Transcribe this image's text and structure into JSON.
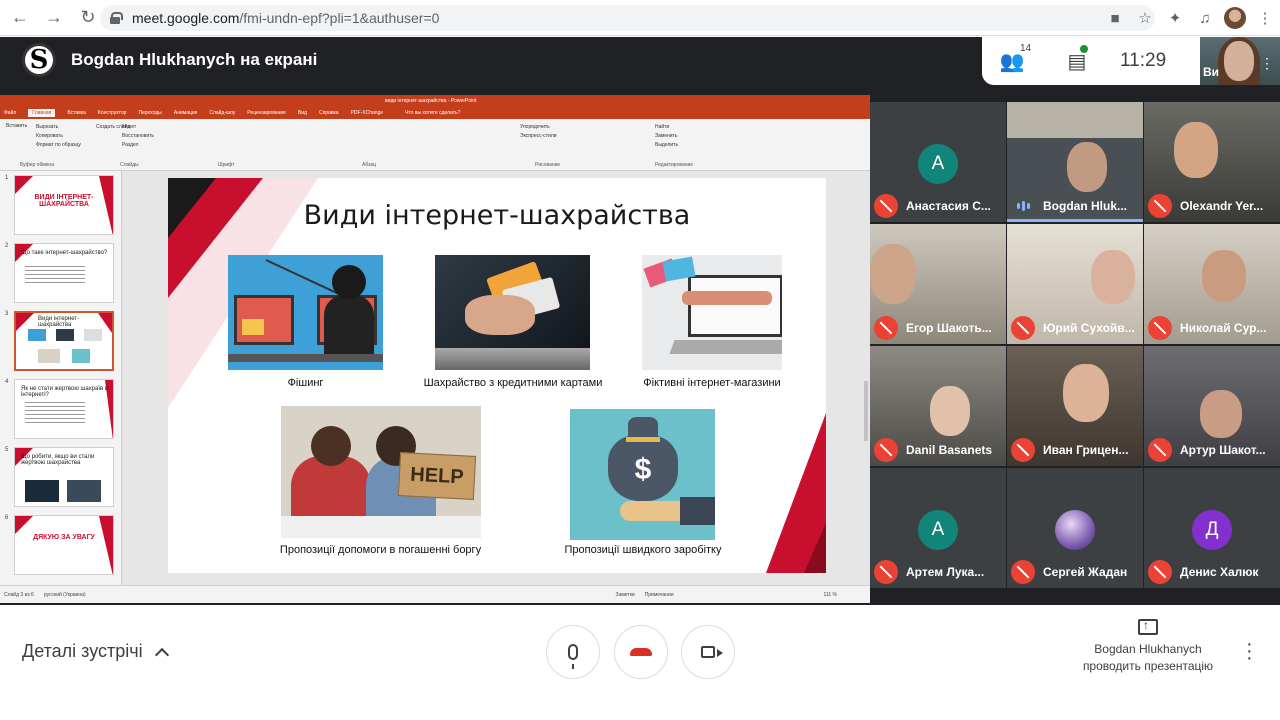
{
  "browser": {
    "url_host": "meet.google.com",
    "url_path": "/fmi-undn-epf?pli=1&authuser=0"
  },
  "meet": {
    "presenter_initial": "S",
    "presenter_banner": "Bogdan Hlukhanych на екрані",
    "people_count": "14",
    "time": "11:29",
    "self_label": "Ви"
  },
  "ppt": {
    "doc_title": "види інтернет-шахрайства - PowerPoint",
    "menu": [
      "Файл",
      "Главная",
      "Вставка",
      "Конструктор",
      "Переходы",
      "Анимация",
      "Слайд-шоу",
      "Рецензирование",
      "Вид",
      "Справка",
      "PDF-XChange",
      "Что вы хотите сделать?"
    ],
    "ribbon_groups": [
      "Буфер обмена",
      "Слайды",
      "Шрифт",
      "Абзац",
      "Рисование",
      "Редактирование"
    ],
    "ribbon_items": [
      "Вставить",
      "Вырезать",
      "Копировать",
      "Формат по образцу",
      "Создать слайд",
      "Макет",
      "Восстановить",
      "Раздел",
      "Найти",
      "Заменить",
      "Выделить",
      "Упорядочить",
      "Экспресс-стили"
    ],
    "status": [
      "Слайд 3 из 6",
      "русский (Украина)",
      "Заметки",
      "Примечания",
      "111 %"
    ],
    "thumbs": [
      {
        "num": "1",
        "title": "ВИДИ ІНТЕРНЕТ-ШАХРАЙСТВА"
      },
      {
        "num": "2",
        "title": "Що таке інтернет-шахрайство?"
      },
      {
        "num": "3",
        "title": "Види інтернет-шахрайства"
      },
      {
        "num": "4",
        "title": "Як не стати жертвою шахраїв в інтернеті?"
      },
      {
        "num": "5",
        "title": "Що робити, якщо ви стали жертвою шахрайства"
      },
      {
        "num": "6",
        "title": "ДЯКУЮ ЗА УВАГУ"
      }
    ],
    "slide": {
      "title": "Види інтернет-шахрайства",
      "captions": [
        "Фішинг",
        "Шахрайство з кредитними картами",
        "Фіктивні інтернет-магазини",
        "Пропозиції допомоги в погашенні боргу",
        "Пропозиції швидкого заробітку"
      ],
      "help_sign": "HELP",
      "dollar": "$"
    }
  },
  "participants": [
    {
      "name": "Анастасия С...",
      "initial": "А",
      "type": "avatar",
      "color": "#12857a",
      "muted": true
    },
    {
      "name": "Bogdan Hluk...",
      "type": "video",
      "muted": false
    },
    {
      "name": "Olexandr Yer...",
      "type": "video",
      "muted": true
    },
    {
      "name": "Егор Шакоть...",
      "type": "video",
      "muted": true
    },
    {
      "name": "Юрий Сухойв...",
      "type": "video",
      "muted": true
    },
    {
      "name": "Николай Сур...",
      "type": "video",
      "muted": true
    },
    {
      "name": "Danil Basanets",
      "type": "video",
      "muted": true
    },
    {
      "name": "Иван Грицен...",
      "type": "video",
      "muted": true
    },
    {
      "name": "Артур Шакот...",
      "type": "video",
      "muted": true
    },
    {
      "name": "Артем Лука...",
      "initial": "А",
      "type": "avatar",
      "color": "#12857a",
      "muted": true
    },
    {
      "name": "Сергей Жадан",
      "type": "photo-avatar",
      "muted": true
    },
    {
      "name": "Денис Халюк",
      "initial": "Д",
      "type": "avatar",
      "color": "#8430ce",
      "muted": true
    }
  ],
  "bottom": {
    "details_label": "Деталі зустрічі",
    "presenting_line1": "Bogdan Hlukhanych",
    "presenting_line2": "проводить презентацію"
  },
  "colors": {
    "accent_red": "#c8102e",
    "meet_dark": "#202124",
    "mute_red": "#ea4335"
  }
}
